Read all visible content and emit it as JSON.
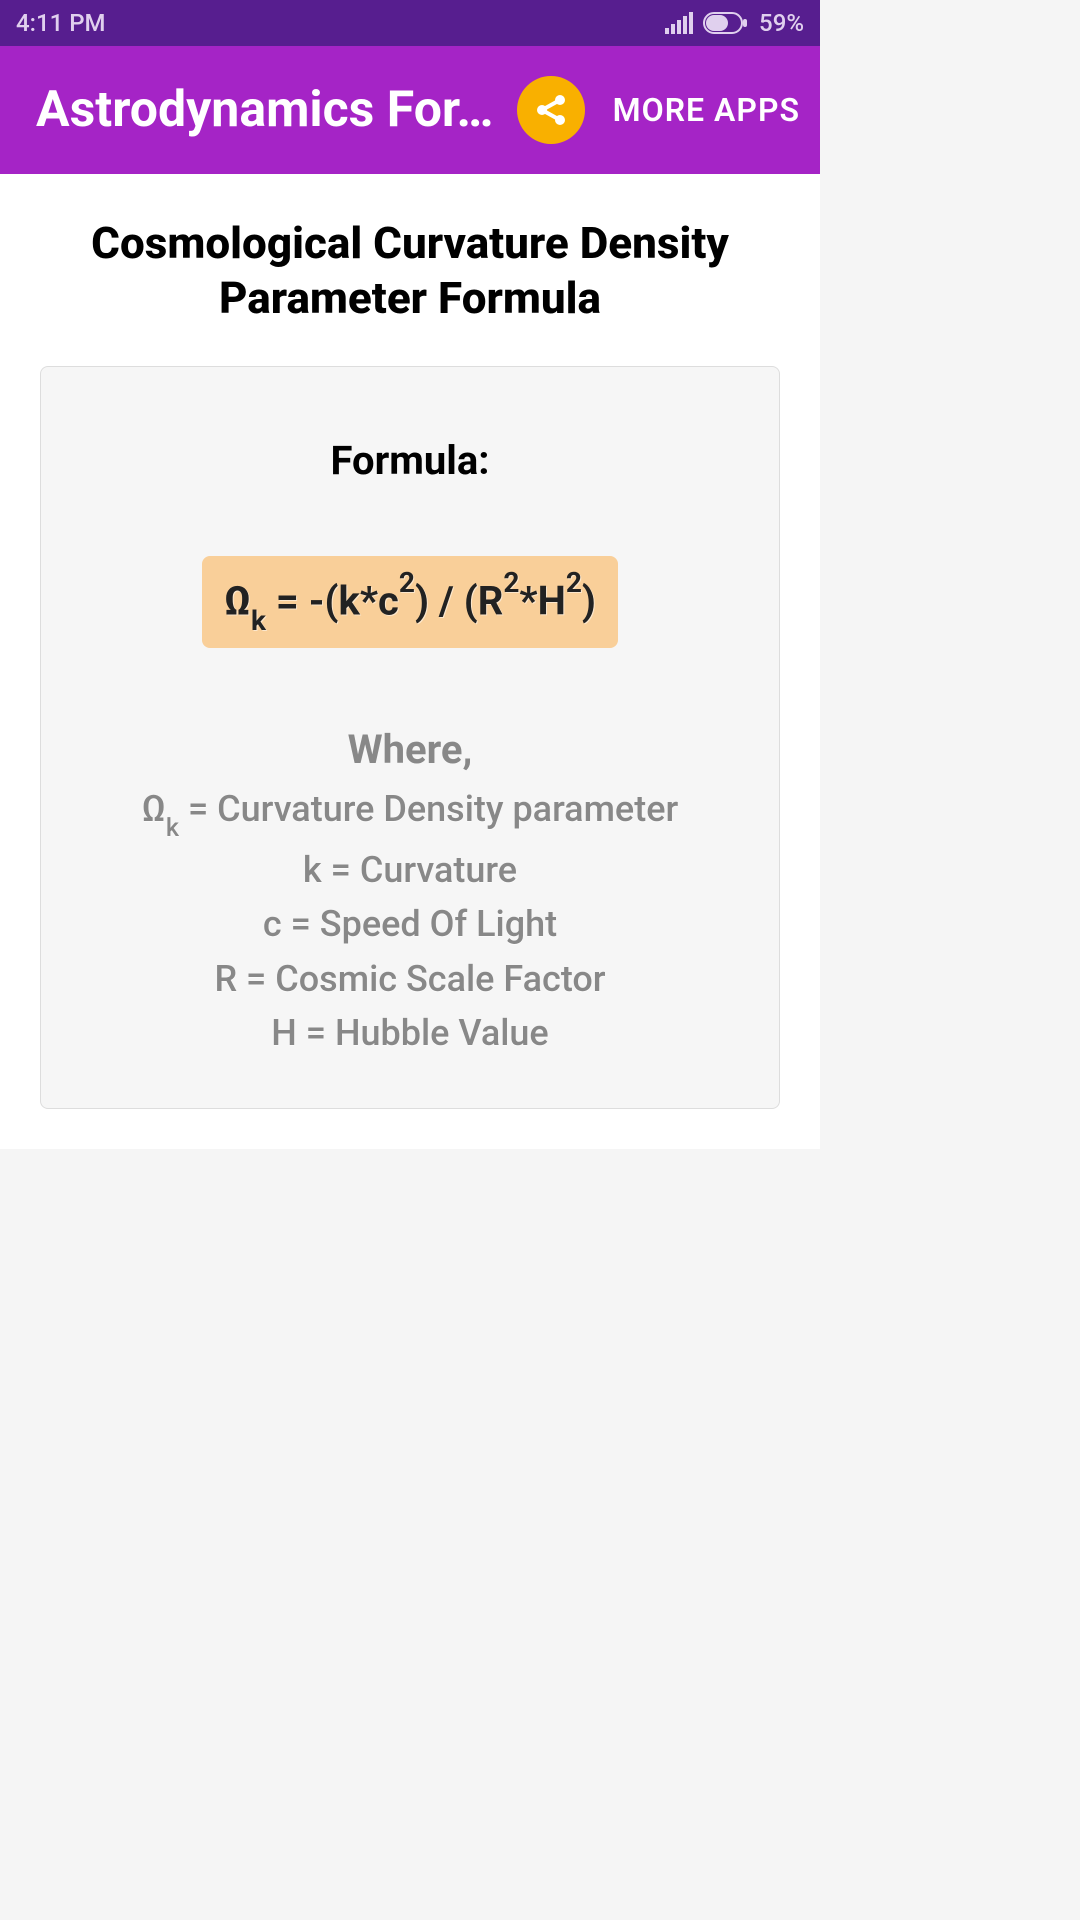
{
  "status": {
    "time": "4:11 PM",
    "battery": "59%"
  },
  "appbar": {
    "title": "Astrodynamics For…",
    "more_apps": "MORE APPS"
  },
  "page": {
    "title": "Cosmological Curvature Density Parameter Formula"
  },
  "card": {
    "formula_label": "Formula:",
    "where_label": "Where,"
  },
  "formula": {
    "omega_symbol": "Ω",
    "omega_sub": "k",
    "part1": " = -(k*c",
    "sup1": "2",
    "part2": ") / (R",
    "sup2": "2",
    "part3": "*H",
    "sup3": "2",
    "part4": ")"
  },
  "definitions": {
    "d0_sym": "Ω",
    "d0_sub": "k",
    "d0_rest": " = Curvature Density parameter",
    "d1": "k = Curvature",
    "d2": "c = Speed Of Light",
    "d3": "R = Cosmic Scale Factor",
    "d4": "H = Hubble Value"
  }
}
